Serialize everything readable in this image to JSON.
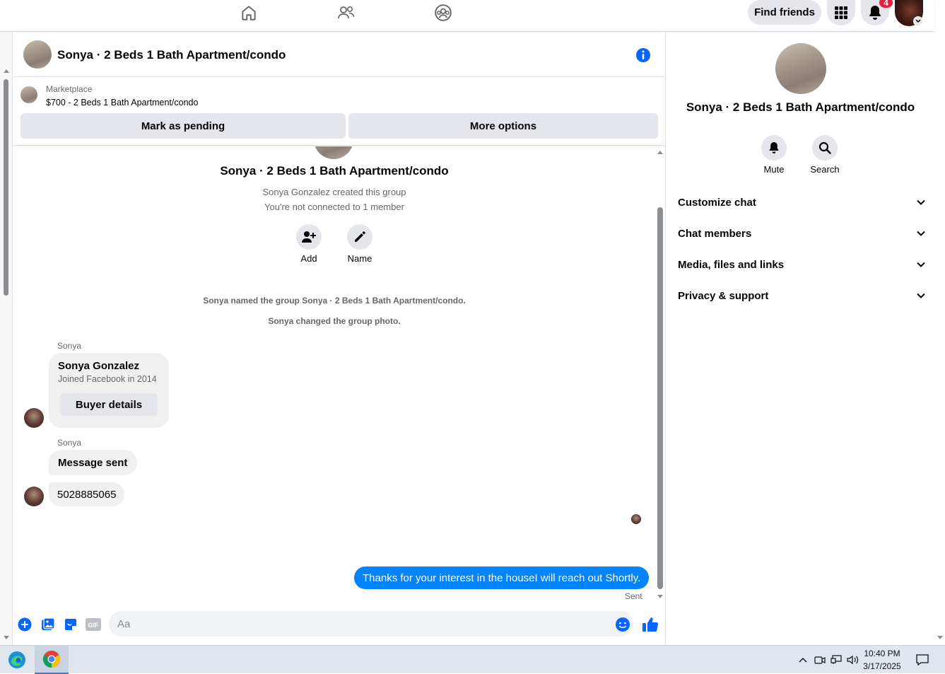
{
  "topnav": {
    "find_friends_label": "Find friends",
    "notification_count": "4"
  },
  "chat": {
    "title": "Sonya · 2 Beds 1 Bath Apartment/condo",
    "marketplace": {
      "label": "Marketplace",
      "item": "$700 - 2 Beds 1 Bath Apartment/condo",
      "mark_pending_label": "Mark as pending",
      "more_options_label": "More options"
    },
    "intro": {
      "group_name": "Sonya · 2 Beds 1 Bath Apartment/condo",
      "created_by": "Sonya Gonzalez created this group",
      "not_connected": "You're not connected to 1 member",
      "add_label": "Add",
      "name_label": "Name"
    },
    "events": [
      "Sonya named the group Sonya · 2 Beds 1 Bath Apartment/condo.",
      "Sonya changed the group photo."
    ],
    "messages": {
      "card_sender": "Sonya",
      "card_name": "Sonya Gonzalez",
      "card_joined": "Joined Facebook in 2014",
      "card_button": "Buyer details",
      "msg2_sender": "Sonya",
      "msg2_text": "Message sent",
      "msg3_text": "5028885065",
      "outgoing_text": "Thanks for your interest in the houseI will reach out Shortly.",
      "outgoing_status": "Sent"
    },
    "composer": {
      "placeholder": "Aa"
    }
  },
  "right_panel": {
    "title": "Sonya · 2 Beds 1 Bath Apartment/condo",
    "mute_label": "Mute",
    "search_label": "Search",
    "sections": [
      "Customize chat",
      "Chat members",
      "Media, files and links",
      "Privacy & support"
    ]
  },
  "taskbar": {
    "time": "10:40 PM",
    "date": "3/17/2025"
  },
  "colors": {
    "accent": "#0866ff",
    "outgoing_bubble": "#0084ff",
    "badge": "#e41e3f"
  }
}
